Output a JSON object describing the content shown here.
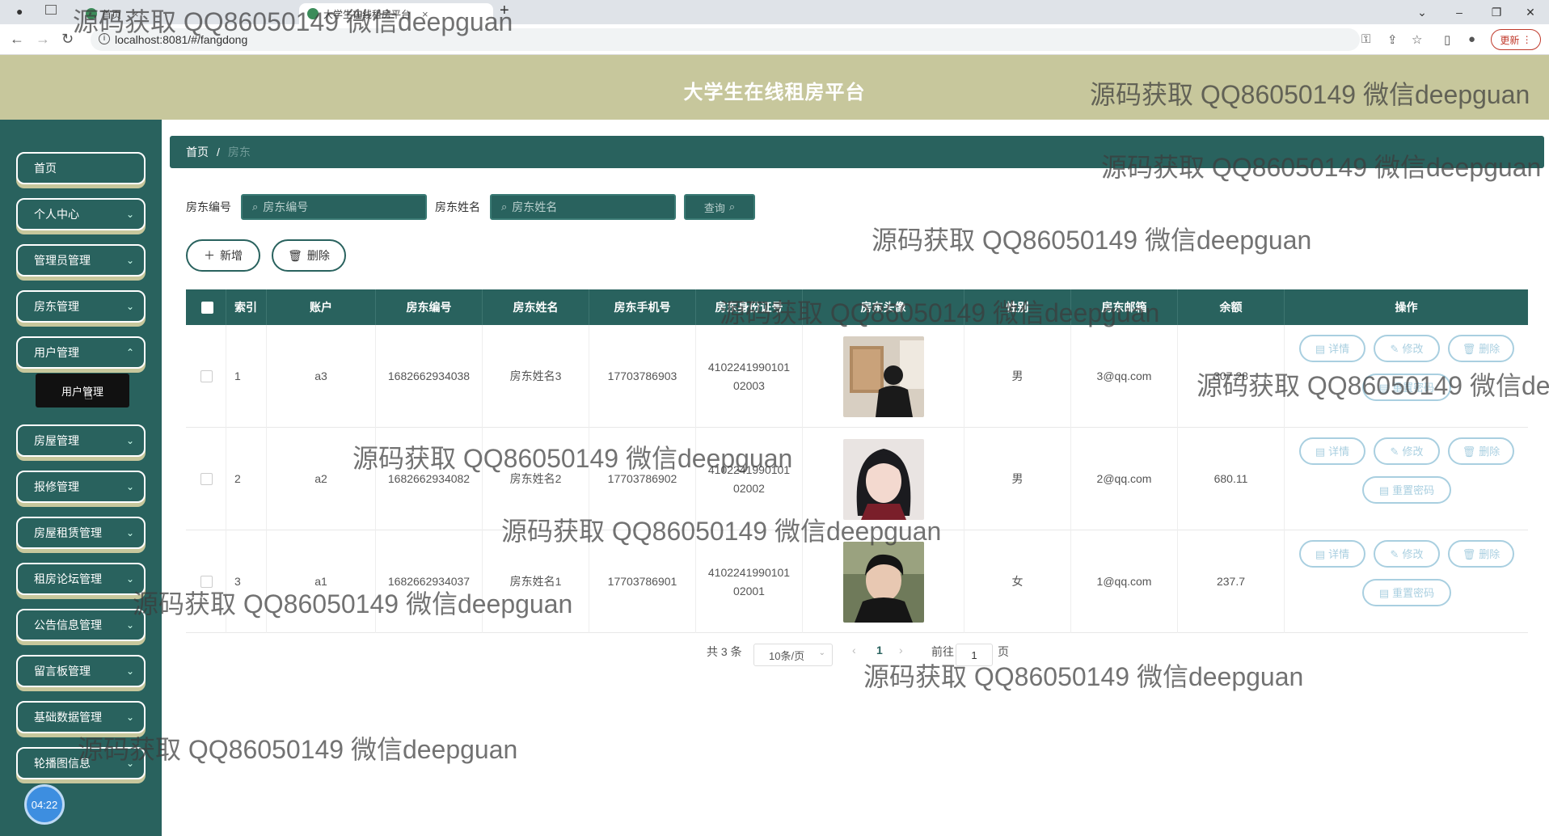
{
  "browser": {
    "tabs": [
      {
        "label": "首页",
        "active": false
      },
      {
        "label": "大学生在线租房平台",
        "active": true
      }
    ],
    "url": "localhost:8081/#/fangdong",
    "update_label": "更新"
  },
  "header": {
    "title": "大学生在线租房平台"
  },
  "breadcrumb": {
    "home": "首页",
    "separator": "/",
    "current": "房东"
  },
  "sidebar": {
    "items": [
      {
        "label": "首页"
      },
      {
        "label": "个人中心"
      },
      {
        "label": "管理员管理"
      },
      {
        "label": "房东管理"
      },
      {
        "label": "用户管理"
      },
      {
        "label": "房屋管理"
      },
      {
        "label": "报修管理"
      },
      {
        "label": "房屋租赁管理"
      },
      {
        "label": "租房论坛管理"
      },
      {
        "label": "公告信息管理"
      },
      {
        "label": "留言板管理"
      },
      {
        "label": "基础数据管理"
      },
      {
        "label": "轮播图信息"
      }
    ],
    "submenu": "用户管理",
    "clock": "04:22"
  },
  "filters": {
    "field1_label": "房东编号",
    "field1_placeholder": "房东编号",
    "field2_label": "房东姓名",
    "field2_placeholder": "房东姓名",
    "query_label": "查询"
  },
  "actions": {
    "add_label": "新增",
    "delete_label": "删除"
  },
  "table": {
    "columns": [
      "索引",
      "账户",
      "房东编号",
      "房东姓名",
      "房东手机号",
      "房东身份证号",
      "房东头像",
      "性别",
      "房东邮箱",
      "余额",
      "操作"
    ],
    "rows": [
      {
        "index": "1",
        "account": "a3",
        "id": "1682662934038",
        "name": "房东姓名3",
        "phone": "17703786903",
        "idcard1": "4102241990101",
        "idcard2": "02003",
        "gender": "男",
        "email": "3@qq.com",
        "balance": "307.28"
      },
      {
        "index": "2",
        "account": "a2",
        "id": "1682662934082",
        "name": "房东姓名2",
        "phone": "17703786902",
        "idcard1": "4102241990101",
        "idcard2": "02002",
        "gender": "男",
        "email": "2@qq.com",
        "balance": "680.11"
      },
      {
        "index": "3",
        "account": "a1",
        "id": "1682662934037",
        "name": "房东姓名1",
        "phone": "17703786901",
        "idcard1": "4102241990101",
        "idcard2": "02001",
        "gender": "女",
        "email": "1@qq.com",
        "balance": "237.7"
      }
    ],
    "op_labels": {
      "detail": "详情",
      "edit": "修改",
      "delete": "删除",
      "reset": "重置密码"
    }
  },
  "pagination": {
    "total": "共 3 条",
    "page_size": "10条/页",
    "current_page": "1",
    "goto_label": "前往",
    "goto_value": "1",
    "page_unit": "页"
  },
  "watermark": "源码获取 QQ86050149 微信deepguan",
  "colors": {
    "sidebar": "#29625e",
    "header": "#c7c79c",
    "accent": "#29625e",
    "op_button": "#a9cfe0"
  }
}
